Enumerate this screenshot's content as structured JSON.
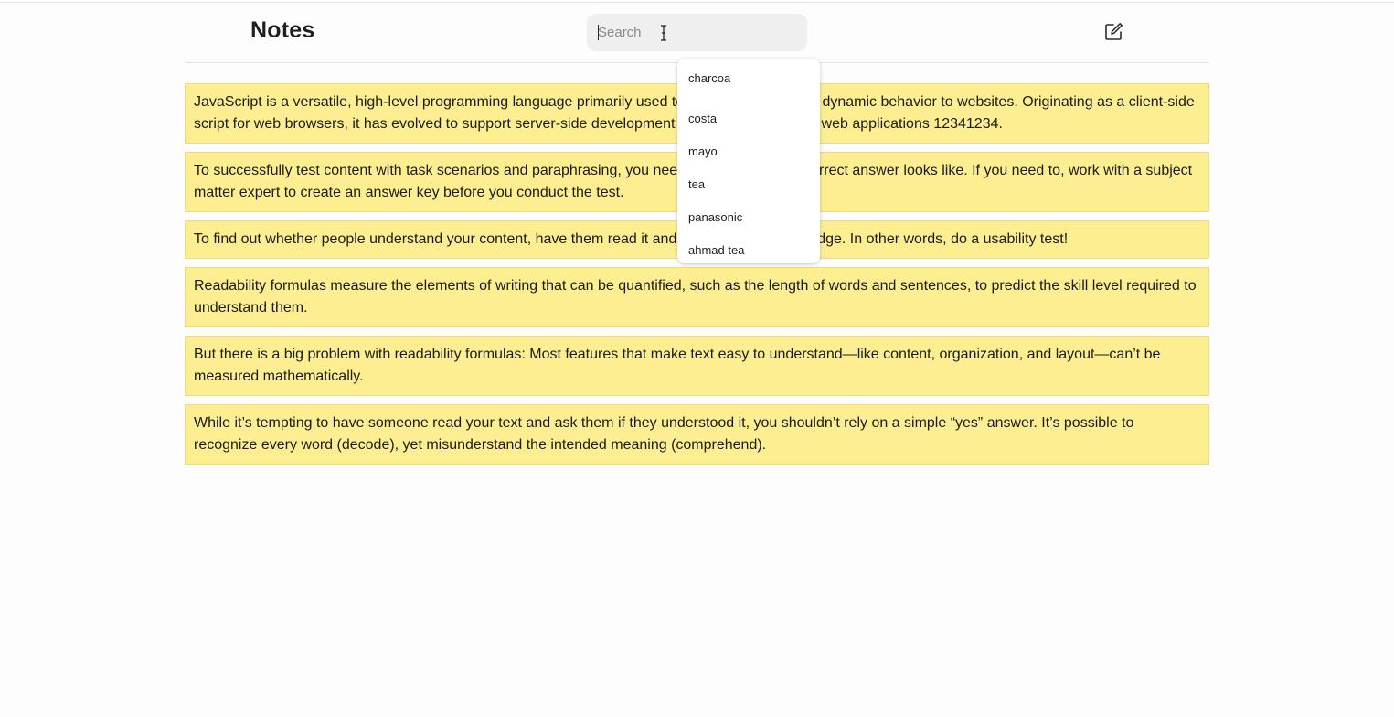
{
  "header": {
    "title": "Notes",
    "search": {
      "value": "",
      "placeholder": "Search"
    },
    "compose_icon": "compose-icon"
  },
  "suggestions": [
    "charcoa",
    "costa",
    "mayo",
    "tea",
    "panasonic",
    "ahmad tea"
  ],
  "notes": [
    "JavaScript is a versatile, high-level programming language primarily used to add interactivity and dynamic behavior to websites. Originating as a client-side script for web browsers, it has evolved to support server-side development and is now integral to web applications 12341234.",
    "To successfully test content with task scenarios and paraphrasing, you need to know what the correct answer looks like. If you need to, work with a subject matter expert to create an answer key before you conduct the test.",
    "To find out whether people understand your content, have them read it and test their new knowledge. In other words, do a usability test!",
    "Readability formulas measure the elements of writing that can be quantified, such as the length of words and sentences, to predict the skill level required to understand them.",
    "But there is a big problem with readability formulas: Most features that make text easy to understand—like content, organization, and layout—can’t be measured mathematically.",
    "While it’s tempting to have someone read your text and ask them if they understood it, you shouldn’t rely on a simple “yes” answer. It’s possible to recognize every word (decode), yet misunderstand the intended meaning (comprehend)."
  ],
  "colors": {
    "note_background": "#fdef91",
    "note_border": "#ebdd7d",
    "search_background": "#efefef"
  }
}
